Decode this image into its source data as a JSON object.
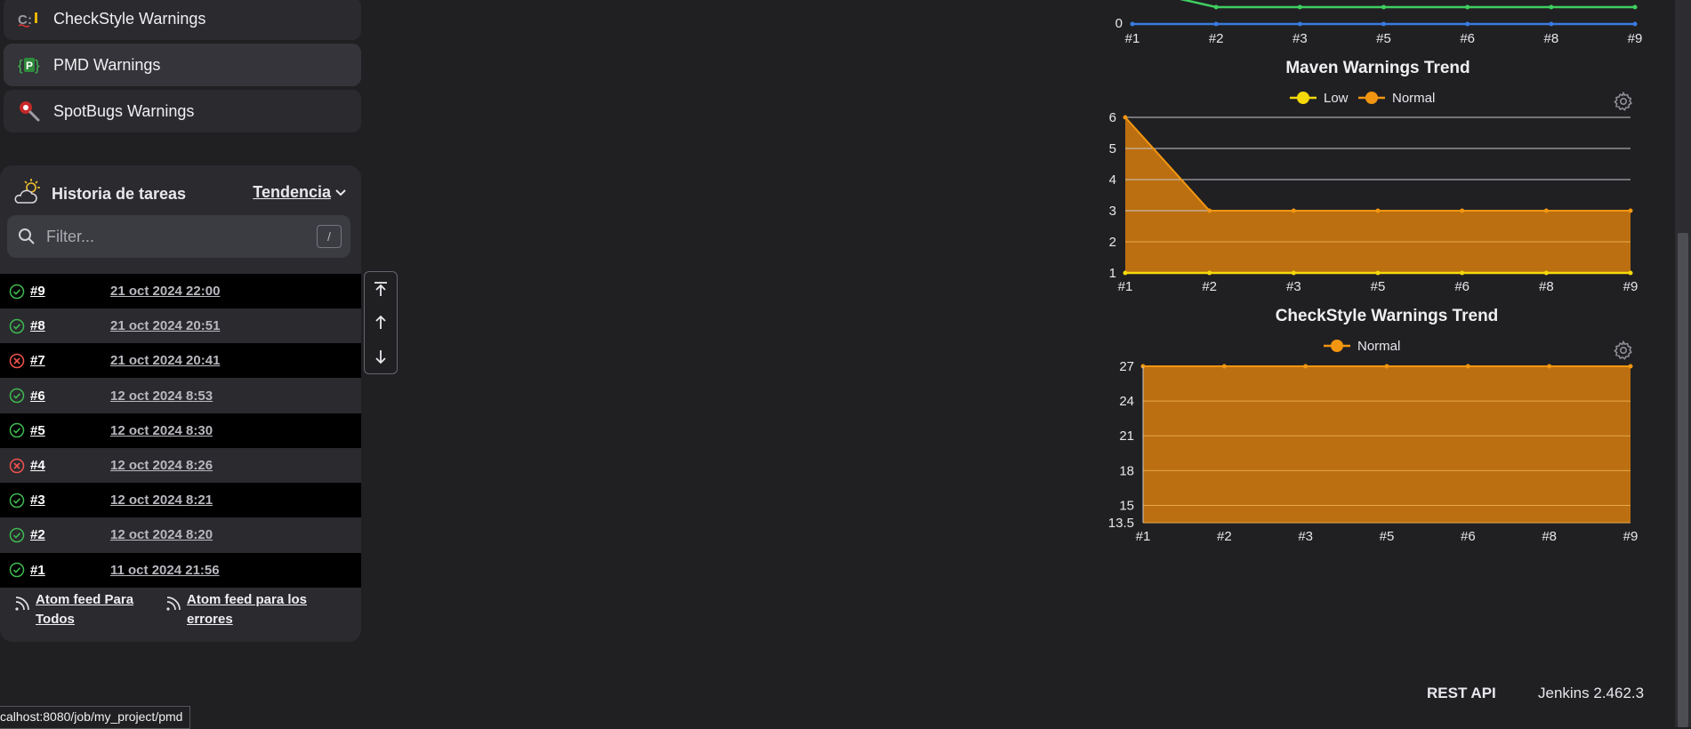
{
  "sidebar": {
    "links": [
      {
        "label": "CheckStyle Warnings",
        "icon": "checkstyle-icon"
      },
      {
        "label": "PMD Warnings",
        "icon": "pmd-icon"
      },
      {
        "label": "SpotBugs Warnings",
        "icon": "spotbugs-icon"
      }
    ]
  },
  "history": {
    "title": "Historia de tareas",
    "trend_label": "Tendencia",
    "filter_placeholder": "Filter...",
    "filter_shortcut": "/",
    "builds": [
      {
        "number": "#9",
        "date": "21 oct 2024 22:00",
        "status": "success"
      },
      {
        "number": "#8",
        "date": "21 oct 2024 20:51",
        "status": "success"
      },
      {
        "number": "#7",
        "date": "21 oct 2024 20:41",
        "status": "failed"
      },
      {
        "number": "#6",
        "date": "12 oct 2024 8:53",
        "status": "success"
      },
      {
        "number": "#5",
        "date": "12 oct 2024 8:30",
        "status": "success"
      },
      {
        "number": "#4",
        "date": "12 oct 2024 8:26",
        "status": "failed"
      },
      {
        "number": "#3",
        "date": "12 oct 2024 8:21",
        "status": "success"
      },
      {
        "number": "#2",
        "date": "12 oct 2024 8:20",
        "status": "success"
      },
      {
        "number": "#1",
        "date": "11 oct 2024 21:56",
        "status": "success"
      }
    ],
    "feeds": [
      "Atom feed Para Todos",
      "Atom feed para los errores"
    ]
  },
  "colors": {
    "success": "#3fb950",
    "failed": "#f0524f",
    "low": "#f5d90a",
    "normal": "#f29611",
    "normal_fill": "#bb6f10",
    "blue": "#3a7be0",
    "green": "#3fd05f"
  },
  "chart_data": [
    {
      "type": "line",
      "title": "",
      "categories": [
        "#1",
        "#2",
        "#3",
        "#5",
        "#6",
        "#8",
        "#9"
      ],
      "y_ticks_visible": [
        "0"
      ],
      "series": [
        {
          "values": [
            0,
            0,
            0,
            0,
            0,
            0,
            0
          ],
          "color": "blue"
        },
        {
          "values": [
            null,
            1,
            1,
            1,
            1,
            1,
            1
          ],
          "color": "green"
        }
      ]
    },
    {
      "type": "area",
      "title": "Maven Warnings Trend",
      "categories": [
        "#1",
        "#2",
        "#3",
        "#5",
        "#6",
        "#8",
        "#9"
      ],
      "ylim": [
        1,
        6
      ],
      "y_ticks": [
        1,
        2,
        3,
        4,
        5,
        6
      ],
      "legend": "top-center",
      "series": [
        {
          "name": "Low",
          "values": [
            1,
            1,
            1,
            1,
            1,
            1,
            1
          ]
        },
        {
          "name": "Normal",
          "values": [
            6,
            3,
            3,
            3,
            3,
            3,
            3
          ]
        }
      ]
    },
    {
      "type": "area",
      "title": "CheckStyle Warnings Trend",
      "categories": [
        "#1",
        "#2",
        "#3",
        "#5",
        "#6",
        "#8",
        "#9"
      ],
      "ylim": [
        13.5,
        27
      ],
      "y_ticks": [
        13.5,
        15,
        18,
        21,
        24,
        27
      ],
      "legend": "top-center",
      "series": [
        {
          "name": "Normal",
          "values": [
            27,
            27,
            27,
            27,
            27,
            27,
            27
          ]
        }
      ]
    }
  ],
  "footer": {
    "rest_api": "REST API",
    "version": "Jenkins 2.462.3"
  },
  "status_bar": {
    "url": "calhost:8080/job/my_project/pmd"
  }
}
